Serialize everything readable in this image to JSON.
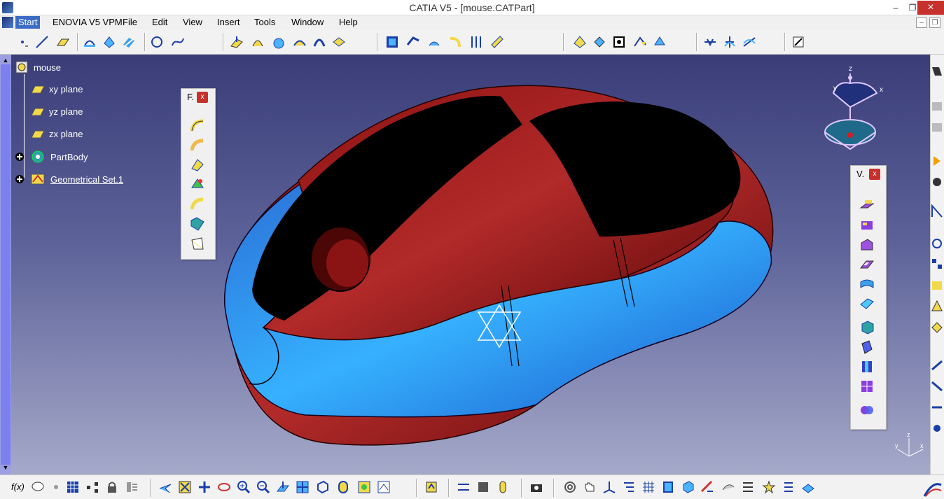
{
  "window": {
    "title": "CATIA V5 - [mouse.CATPart]",
    "controls": {
      "minimize": "–",
      "restore": "❐",
      "close": "×"
    }
  },
  "menubar": {
    "items": [
      "Start",
      "ENOVIA V5 VPM",
      "File",
      "Edit",
      "View",
      "Insert",
      "Tools",
      "Window",
      "Help"
    ],
    "mdi": {
      "minimize": "–",
      "restore": "❐"
    }
  },
  "tree": {
    "root": "mouse",
    "items": [
      {
        "label": "xy plane",
        "icon": "plane-icon"
      },
      {
        "label": "yz plane",
        "icon": "plane-icon"
      },
      {
        "label": "zx plane",
        "icon": "plane-icon"
      },
      {
        "label": "PartBody",
        "icon": "gear-icon"
      },
      {
        "label": "Geometrical Set.1",
        "icon": "geometrical-set-icon"
      }
    ]
  },
  "floating_toolbars": {
    "left": {
      "title": "F.",
      "close": "x"
    },
    "right": {
      "title": "V.",
      "close": "x"
    }
  },
  "compass_labels": {
    "z": "z",
    "y": "y",
    "x": "x"
  },
  "axis_labels": {
    "x": "x",
    "y": "y",
    "z": "z"
  },
  "bottom_toolbar": {
    "formula": "f(x)"
  },
  "colors": {
    "body_red": "#7a0c0c",
    "blue_band": "#1f86e8",
    "black_panel": "#000000",
    "viewport_top": "#3a3d78",
    "viewport_bottom": "#a5a9c9",
    "accent": "#3b6bc4"
  }
}
